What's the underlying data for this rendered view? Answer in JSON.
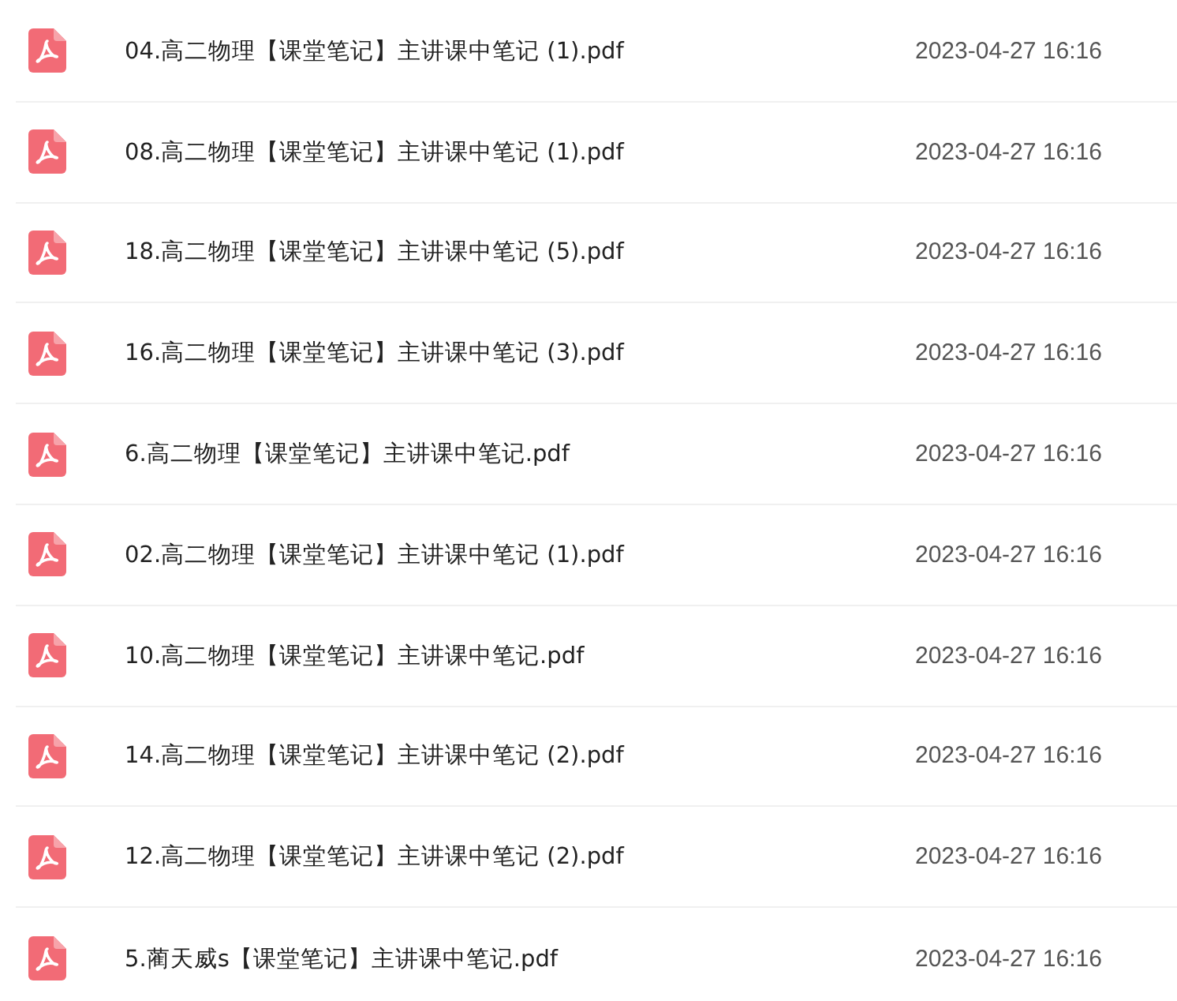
{
  "files": [
    {
      "name": "04.高二物理【课堂笔记】主讲课中笔记 (1).pdf",
      "date": "2023-04-27 16:16"
    },
    {
      "name": "08.高二物理【课堂笔记】主讲课中笔记 (1).pdf",
      "date": "2023-04-27 16:16"
    },
    {
      "name": "18.高二物理【课堂笔记】主讲课中笔记 (5).pdf",
      "date": "2023-04-27 16:16"
    },
    {
      "name": "16.高二物理【课堂笔记】主讲课中笔记 (3).pdf",
      "date": "2023-04-27 16:16"
    },
    {
      "name": "6.高二物理【课堂笔记】主讲课中笔记.pdf",
      "date": "2023-04-27 16:16"
    },
    {
      "name": "02.高二物理【课堂笔记】主讲课中笔记 (1).pdf",
      "date": "2023-04-27 16:16"
    },
    {
      "name": "10.高二物理【课堂笔记】主讲课中笔记.pdf",
      "date": "2023-04-27 16:16"
    },
    {
      "name": "14.高二物理【课堂笔记】主讲课中笔记 (2).pdf",
      "date": "2023-04-27 16:16"
    },
    {
      "name": "12.高二物理【课堂笔记】主讲课中笔记 (2).pdf",
      "date": "2023-04-27 16:16"
    },
    {
      "name": "5.蔺天威s【课堂笔记】主讲课中笔记.pdf",
      "date": "2023-04-27 16:16"
    }
  ]
}
